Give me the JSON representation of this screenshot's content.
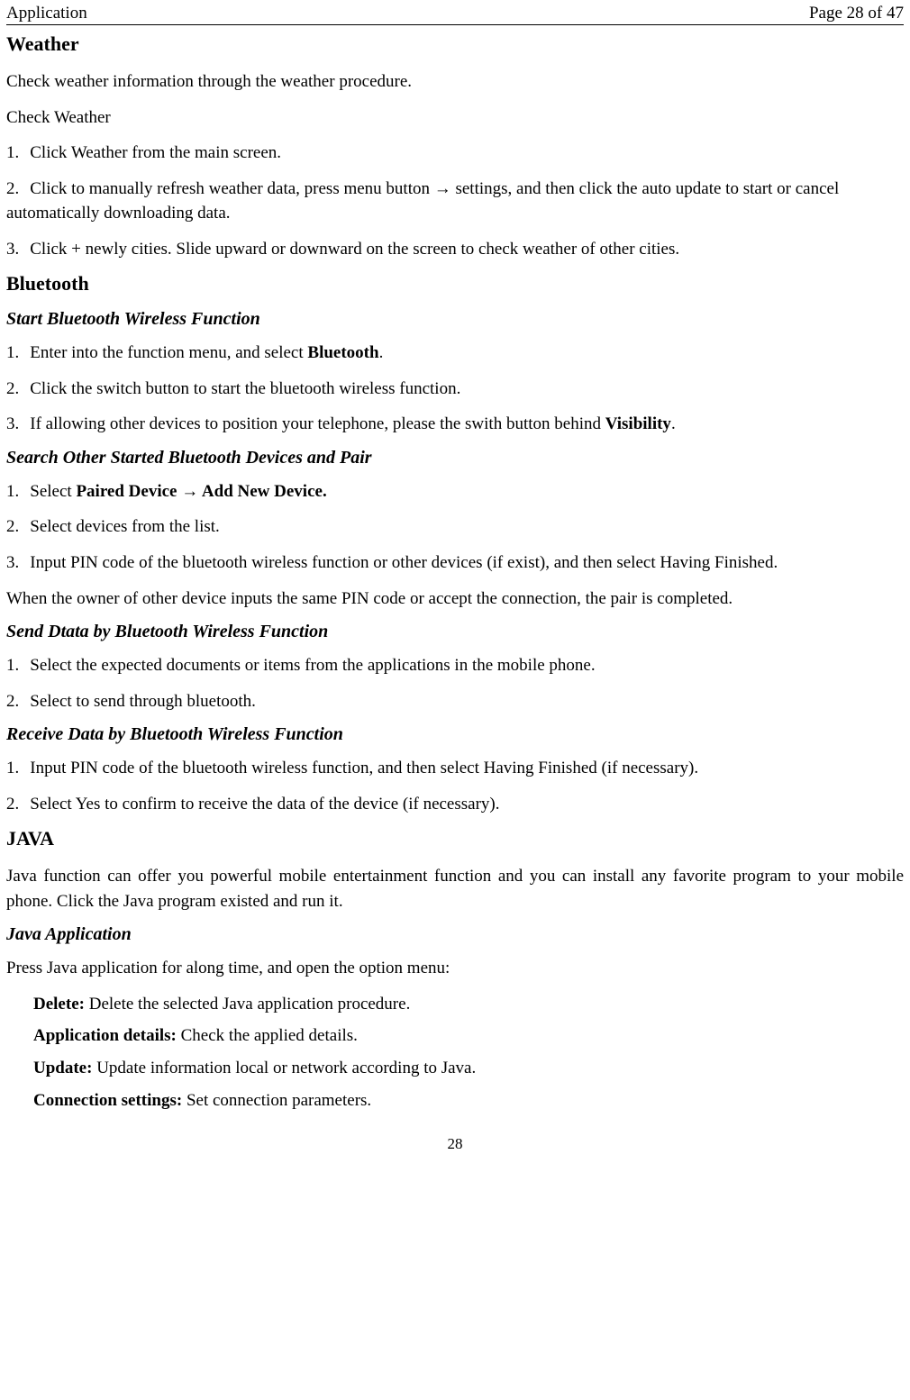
{
  "header": {
    "left": "Application",
    "right": "Page 28 of 47"
  },
  "weather": {
    "title": "Weather",
    "intro": "Check weather information through the weather procedure.",
    "subtitle": "Check Weather",
    "s1_n": "1.",
    "s1_t": "Click Weather from the main screen.",
    "s2_n": "2.",
    "s2_t": "Click to manually refresh weather data, press menu button → settings, and then click the auto update to start or cancel automatically downloading data.",
    "s3_n": "3.",
    "s3_t": "Click + newly cities. Slide upward or downward on the screen to check weather of other cities."
  },
  "bluetooth": {
    "title": "Bluetooth",
    "start_h": "Start Bluetooth Wireless Function",
    "st1_n": "1.",
    "st1_a": "Enter into the function menu, and select ",
    "st1_b": "Bluetooth",
    "st1_c": ".",
    "st2_n": "2.",
    "st2_t": "Click the switch button to start the bluetooth wireless function.",
    "st3_n": "3.",
    "st3_a": "If allowing other devices to position your telephone, please the swith button behind ",
    "st3_b": "Visibility",
    "st3_c": ".",
    "search_h": "Search Other Started Bluetooth Devices and Pair",
    "se1_n": "1.",
    "se1_a": "Select ",
    "se1_b": "Paired Device → Add New Device.",
    "se2_n": "2.",
    "se2_t": "Select devices from the list.",
    "se3_n": "3.",
    "se3_t": "Input PIN code of the bluetooth wireless function or other devices (if exist), and then select Having Finished.",
    "search_p": "When the owner of other device inputs the same PIN code or accept the connection, the pair is completed.",
    "send_h": "Send Dtata by Bluetooth Wireless Function",
    "sd1_n": "1.",
    "sd1_t": "Select the expected documents or items from the applications in the mobile phone.",
    "sd2_n": "2.",
    "sd2_t": "Select to send through bluetooth.",
    "recv_h": "Receive Data by Bluetooth Wireless Function",
    "rc1_n": "1.",
    "rc1_t": "Input PIN code of the bluetooth wireless function, and then select Having Finished (if necessary).",
    "rc2_n": "2.",
    "rc2_t": "Select Yes to confirm to receive the data of the device (if necessary)."
  },
  "java": {
    "title": "JAVA",
    "intro": "Java function can offer you powerful mobile entertainment function and you can install any favorite program to your mobile phone. Click the Java program existed and run it.",
    "app_h": "Java Application",
    "app_p": "Press Java application for along time, and open the option menu:",
    "i1_b": "Delete: ",
    "i1_t": "Delete the selected Java application procedure.",
    "i2_b": "Application details: ",
    "i2_t": "Check the applied details.",
    "i3_b": "Update: ",
    "i3_t": "Update information local or network according to Java.",
    "i4_b": "Connection settings: ",
    "i4_t": "Set connection parameters."
  },
  "footer": {
    "page": "28"
  }
}
